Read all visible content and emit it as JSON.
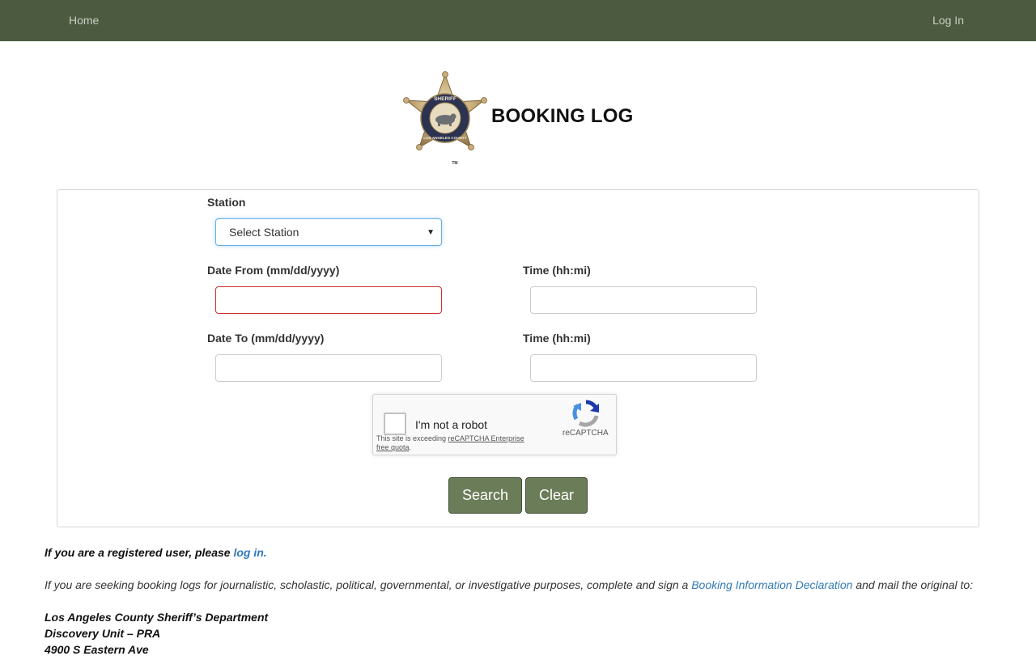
{
  "nav": {
    "home": "Home",
    "login": "Log In"
  },
  "header": {
    "title": "BOOKING LOG",
    "logo": {
      "text_top": "SHERIFF",
      "text_ring": "LOS ANGELES COUNTY",
      "tm": "TM"
    }
  },
  "form": {
    "station": {
      "label": "Station",
      "value": "Select Station"
    },
    "date_from": {
      "label": "Date From (mm/dd/yyyy)",
      "value": ""
    },
    "time_from": {
      "label": "Time (hh:mi)",
      "value": ""
    },
    "date_to": {
      "label": "Date To (mm/dd/yyyy)",
      "value": ""
    },
    "time_to": {
      "label": "Time (hh:mi)",
      "value": ""
    },
    "recaptcha": {
      "label": "I'm not a robot",
      "note_prefix": "This site is exceeding ",
      "note_link": "reCAPTCHA Enterprise free quota",
      "note_suffix": ".",
      "brand": "reCAPTCHA"
    },
    "search_label": "Search",
    "clear_label": "Clear"
  },
  "info": {
    "registered_prefix": "If you are a registered user, please ",
    "registered_link": "log in.",
    "seeking_prefix": "If you are seeking booking logs for journalistic, scholastic, political, governmental, or investigative purposes, complete and sign a ",
    "seeking_link": "Booking Information Declaration",
    "seeking_suffix": " and mail the original to:",
    "address_line1": "Los Angeles County Sheriff’s Department",
    "address_line2": "Discovery Unit – PRA",
    "address_line3": "4900 S Eastern Ave"
  },
  "colors": {
    "navbar": "#4c5a40",
    "button": "#6b7d58",
    "link": "#337ab7",
    "invalid_border": "#c9302c"
  }
}
